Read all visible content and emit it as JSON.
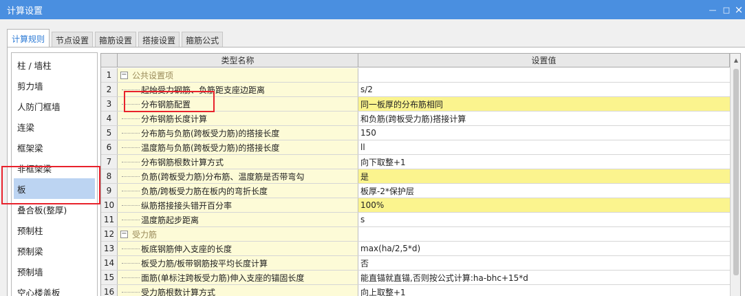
{
  "window": {
    "title": "计算设置",
    "minimize": "—",
    "maximize": "□",
    "close": "×"
  },
  "tabs": [
    {
      "label": "计算规则",
      "active": true
    },
    {
      "label": "节点设置",
      "active": false
    },
    {
      "label": "箍筋设置",
      "active": false
    },
    {
      "label": "搭接设置",
      "active": false
    },
    {
      "label": "箍筋公式",
      "active": false
    }
  ],
  "sidebar": {
    "selected": "板",
    "items": [
      "柱 / 墙柱",
      "剪力墙",
      "人防门框墙",
      "连梁",
      "框架梁",
      "非框架梁",
      "板",
      "叠合板(整厚)",
      "预制柱",
      "预制梁",
      "预制墙",
      "空心楼盖板"
    ]
  },
  "grid": {
    "columns": {
      "name": "类型名称",
      "value": "设置值"
    },
    "expander_symbol": "−",
    "rows": [
      {
        "num": "1",
        "name": "公共设置项",
        "value": "",
        "group": true
      },
      {
        "num": "2",
        "name": "起始受力钢筋、负筋距支座边距离",
        "value": "s/2"
      },
      {
        "num": "3",
        "name": "分布钢筋配置",
        "value": "同一板厚的分布筋相同",
        "highlight": true
      },
      {
        "num": "4",
        "name": "分布钢筋长度计算",
        "value": "和负筋(跨板受力筋)搭接计算"
      },
      {
        "num": "5",
        "name": "分布筋与负筋(跨板受力筋)的搭接长度",
        "value": "150"
      },
      {
        "num": "6",
        "name": "温度筋与负筋(跨板受力筋)的搭接长度",
        "value": "ll"
      },
      {
        "num": "7",
        "name": "分布钢筋根数计算方式",
        "value": "向下取整+1"
      },
      {
        "num": "8",
        "name": "负筋(跨板受力筋)分布筋、温度筋是否带弯勾",
        "value": "是",
        "highlight": true
      },
      {
        "num": "9",
        "name": "负筋/跨板受力筋在板内的弯折长度",
        "value": "板厚-2*保护层"
      },
      {
        "num": "10",
        "name": "纵筋搭接接头错开百分率",
        "value": "100%",
        "highlight": true
      },
      {
        "num": "11",
        "name": "温度筋起步距离",
        "value": "s"
      },
      {
        "num": "12",
        "name": "受力筋",
        "value": "",
        "group": true
      },
      {
        "num": "13",
        "name": "板底钢筋伸入支座的长度",
        "value": "max(ha/2,5*d)"
      },
      {
        "num": "14",
        "name": "板受力筋/板带钢筋按平均长度计算",
        "value": "否"
      },
      {
        "num": "15",
        "name": "面筋(单标注跨板受力筋)伸入支座的锚固长度",
        "value": "能直锚就直锚,否则按公式计算:ha-bhc+15*d"
      },
      {
        "num": "16",
        "name": "受力筋根数计算方式",
        "value": "向上取整+1"
      }
    ]
  },
  "colors": {
    "titlebar": "#4a8fe0",
    "name_column": "#fdfbd7",
    "value_highlight": "#fbf48e",
    "selection": "#bcd4f2",
    "annotation": "#e8212b"
  }
}
